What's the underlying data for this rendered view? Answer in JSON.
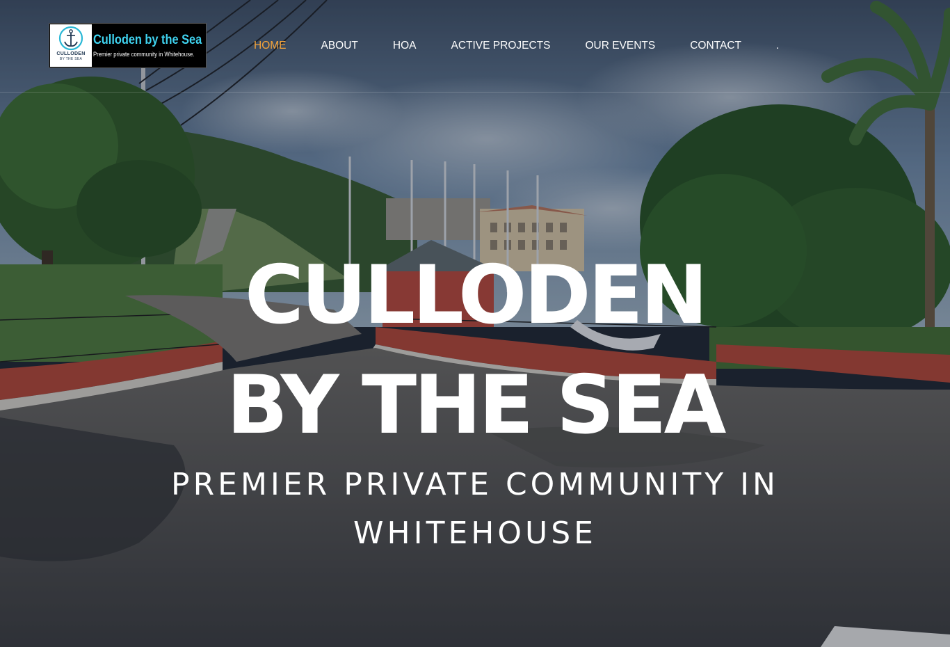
{
  "logo": {
    "badge_line1": "CULLODEN",
    "badge_line2": "BY THE SEA",
    "title": "Culloden by the Sea",
    "tagline": "Premier private community in Whitehouse."
  },
  "nav": {
    "items": [
      {
        "label": "HOME",
        "active": true
      },
      {
        "label": "ABOUT"
      },
      {
        "label": "HOA"
      },
      {
        "label": "ACTIVE PROJECTS"
      },
      {
        "label": "OUR EVENTS"
      },
      {
        "label": "CONTACT"
      },
      {
        "label": "."
      }
    ]
  },
  "hero": {
    "title_line1": "CULLODEN",
    "title_line2": "BY THE SEA",
    "subtitle_line1": "PREMIER PRIVATE COMMUNITY IN",
    "subtitle_line2": "WHITEHOUSE"
  },
  "colors": {
    "nav_active": "#f5a43a",
    "nav_text": "#ffffff",
    "logo_title": "#3fd3f0",
    "logo_bg": "#000000"
  },
  "icons": {
    "logo_badge": "anchor-icon"
  }
}
